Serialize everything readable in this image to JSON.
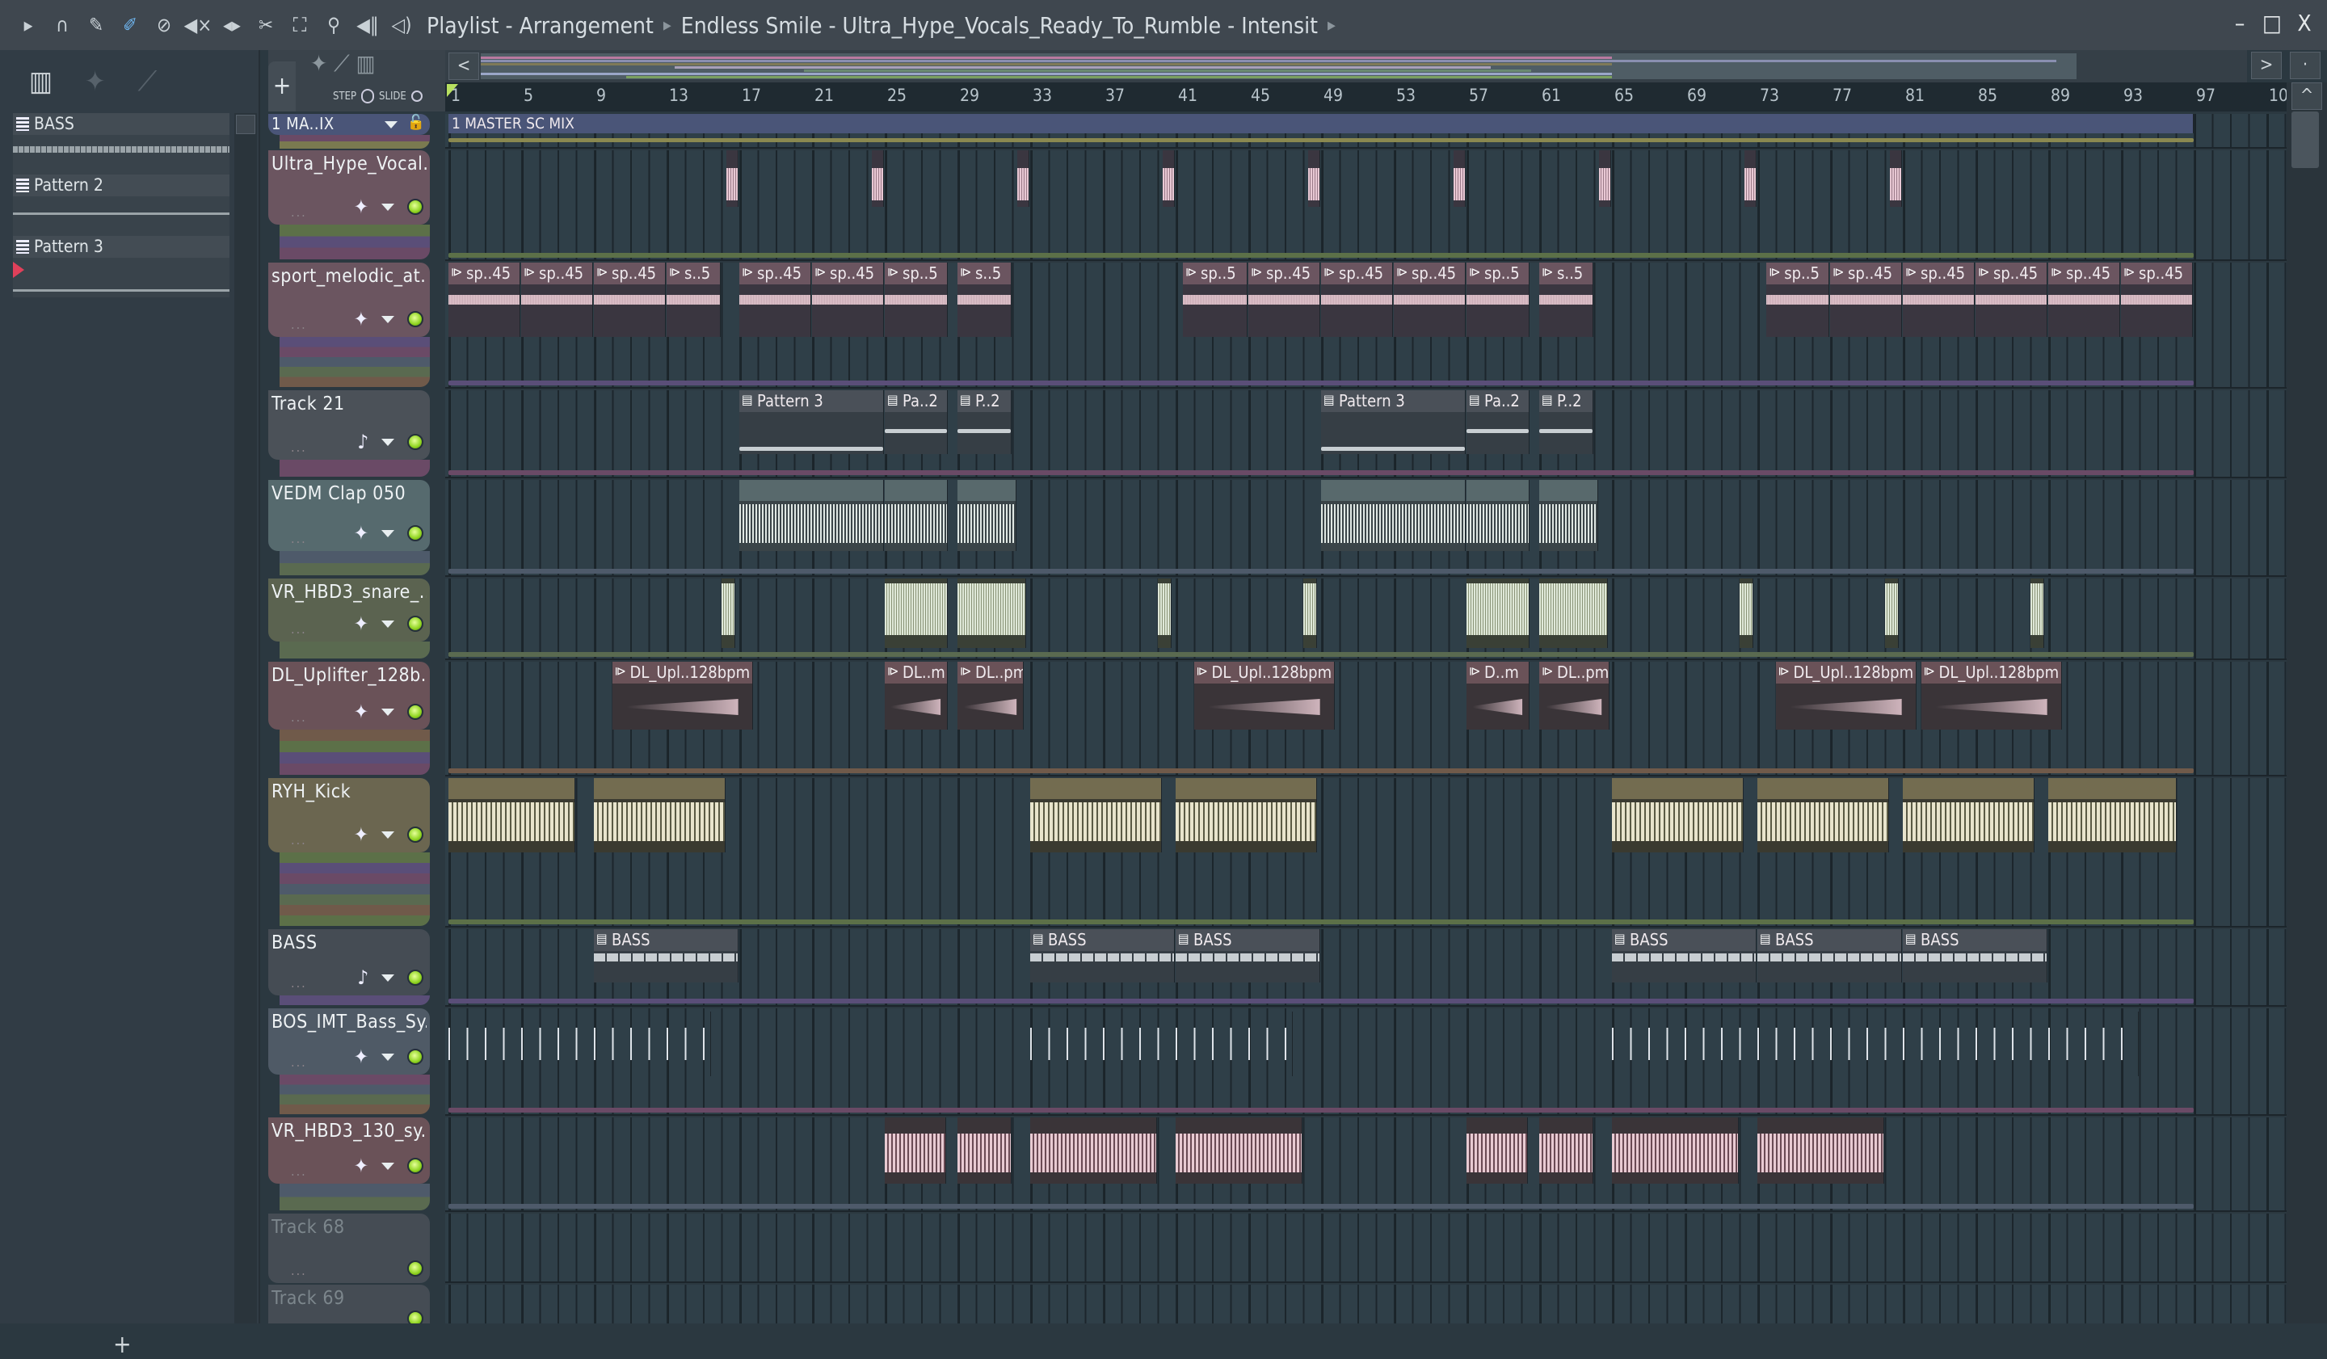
{
  "titlebar": {
    "icons": [
      "play-arrow-icon",
      "magnet-icon",
      "pencil-icon",
      "paint-brush-icon",
      "delete-icon",
      "mute-icon",
      "slip-icon",
      "slice-icon",
      "select-icon",
      "zoom-icon",
      "playback-icon",
      "speaker-icon"
    ],
    "breadcrumb": [
      "Playlist - Arrangement",
      "Endless Smile - Ultra_Hype_Vocals_Ready_To_Rumble - Intensit"
    ],
    "window_buttons": {
      "minimize": "–",
      "maximize": "□",
      "close": "X"
    }
  },
  "picker": {
    "patterns": [
      {
        "label": "BASS"
      },
      {
        "label": "Pattern 2"
      },
      {
        "label": "Pattern 3"
      }
    ],
    "add_label": "+"
  },
  "toolbar": {
    "add_label": "+",
    "step_label": "STEP",
    "slide_label": "SLIDE"
  },
  "overview": {
    "left_label": "<",
    "right_label": ">",
    "up_label": "^"
  },
  "ruler": [
    "1",
    "5",
    "9",
    "13",
    "17",
    "21",
    "25",
    "29",
    "33",
    "37",
    "41",
    "45",
    "49",
    "53",
    "57",
    "61",
    "65",
    "69",
    "73",
    "77",
    "81",
    "85",
    "89",
    "93",
    "97",
    "10"
  ],
  "master": {
    "name": "1 MA..IX",
    "clip_label": "1 MASTER SC MIX"
  },
  "tracks": [
    {
      "name": "Ultra_Hype_Vocal..",
      "kind": "audio",
      "color": "#6b5560",
      "clips": [
        [
          16.3,
          0.7,
          "",
          "vox"
        ],
        [
          24.3,
          0.7,
          "",
          "vox"
        ],
        [
          32.3,
          0.7,
          "",
          "vox"
        ],
        [
          40.3,
          0.7,
          "",
          "vox"
        ],
        [
          48.3,
          0.7,
          "",
          "vox"
        ],
        [
          56.3,
          0.7,
          "",
          "vox"
        ],
        [
          64.3,
          0.7,
          "",
          "vox"
        ],
        [
          72.3,
          0.7,
          "",
          "vox"
        ],
        [
          80.3,
          0.7,
          "",
          "vox"
        ]
      ]
    },
    {
      "name": "sport_melodic_at..",
      "kind": "audio",
      "color": "#6b5560",
      "clips": [
        [
          1,
          4,
          "sp..45",
          "flat"
        ],
        [
          5,
          4,
          "sp..45",
          "flat"
        ],
        [
          9,
          4,
          "sp..45",
          "flat"
        ],
        [
          13,
          3,
          "s..5",
          "flat"
        ],
        [
          17,
          4,
          "sp..45",
          "flat"
        ],
        [
          21,
          4,
          "sp..45",
          "flat"
        ],
        [
          25,
          3.5,
          "sp..5",
          "flat"
        ],
        [
          29,
          3,
          "s..5",
          "flat"
        ],
        [
          41.4,
          3.6,
          "sp..5",
          "flat"
        ],
        [
          45,
          4,
          "sp..45",
          "flat"
        ],
        [
          49,
          4,
          "sp..45",
          "flat"
        ],
        [
          53,
          4,
          "sp..45",
          "flat"
        ],
        [
          57,
          3.5,
          "sp..5",
          "flat"
        ],
        [
          61,
          3,
          "s..5",
          "flat"
        ],
        [
          73.5,
          3.5,
          "sp..5",
          "flat"
        ],
        [
          77,
          4,
          "sp..45",
          "flat"
        ],
        [
          81,
          4,
          "sp..45",
          "flat"
        ],
        [
          85,
          4,
          "sp..45",
          "flat"
        ],
        [
          89,
          4,
          "sp..45",
          "flat"
        ],
        [
          93,
          4,
          "sp..45",
          "flat"
        ]
      ]
    },
    {
      "name": "Track 21",
      "kind": "pattern",
      "color": "#4b5158",
      "clips": [
        [
          17,
          8,
          "Pattern 3",
          "pat"
        ],
        [
          25,
          3.5,
          "Pa..2",
          "pat"
        ],
        [
          29,
          3,
          "P..2",
          "pat"
        ],
        [
          49,
          8,
          "Pattern 3",
          "pat"
        ],
        [
          57,
          3.5,
          "Pa..2",
          "pat"
        ],
        [
          61,
          3,
          "P..2",
          "pat"
        ]
      ]
    },
    {
      "name": "VEDM Clap 050",
      "kind": "audio",
      "color": "#566a6e",
      "clips": [
        [
          17,
          8,
          "",
          "clap"
        ],
        [
          25,
          3.5,
          "",
          "clap"
        ],
        [
          29,
          3.3,
          "",
          "clap"
        ],
        [
          49,
          8,
          "",
          "clap"
        ],
        [
          57,
          3.5,
          "",
          "clap"
        ],
        [
          61,
          3.3,
          "",
          "clap"
        ]
      ]
    },
    {
      "name": "VR_HBD3_snare_..",
      "kind": "audio",
      "color": "#5b6350",
      "clips": [
        [
          16,
          0.8,
          "",
          "snare"
        ],
        [
          25,
          3.5,
          "",
          "snare"
        ],
        [
          29,
          3.8,
          "",
          "snare"
        ],
        [
          40,
          0.8,
          "",
          "snare"
        ],
        [
          48,
          0.8,
          "",
          "snare"
        ],
        [
          57,
          3.5,
          "",
          "snare"
        ],
        [
          61,
          3.8,
          "",
          "snare"
        ],
        [
          72,
          0.8,
          "",
          "snare"
        ],
        [
          80,
          0.8,
          "",
          "snare"
        ],
        [
          88,
          0.8,
          "",
          "snare"
        ]
      ]
    },
    {
      "name": "DL_Uplifter_128b..",
      "kind": "audio",
      "color": "#6a5258",
      "clips": [
        [
          10,
          7.8,
          "DL_Upl..128bpm",
          "rise"
        ],
        [
          25,
          3.5,
          "DL..m",
          "rise"
        ],
        [
          29,
          3.7,
          "DL..pm",
          "rise"
        ],
        [
          42,
          7.8,
          "DL_Upl..128bpm",
          "rise"
        ],
        [
          57,
          3.5,
          "D..m",
          "rise"
        ],
        [
          61,
          3.9,
          "DL..pm",
          "rise"
        ],
        [
          74,
          7.8,
          "DL_Upl..128bpm",
          "rise"
        ],
        [
          82,
          7.8,
          "DL_Upl..128bpm",
          "rise"
        ]
      ]
    },
    {
      "name": "RYH_Kick",
      "kind": "audio",
      "color": "#6b6650",
      "clips": [
        [
          1,
          7,
          "",
          "kick"
        ],
        [
          9,
          7.3,
          "",
          "kick"
        ],
        [
          33,
          7.3,
          "",
          "kick"
        ],
        [
          41,
          7.8,
          "",
          "kick"
        ],
        [
          65,
          7.3,
          "",
          "kick"
        ],
        [
          73,
          7.3,
          "",
          "kick"
        ],
        [
          81,
          7.3,
          "",
          "kick"
        ],
        [
          89,
          7.1,
          "",
          "kick"
        ]
      ]
    },
    {
      "name": "BASS",
      "kind": "pattern",
      "color": "#454c54",
      "clips": [
        [
          9,
          8,
          "BASS",
          "bass"
        ],
        [
          33,
          8,
          "BASS",
          "bass"
        ],
        [
          41,
          8,
          "BASS",
          "bass"
        ],
        [
          65,
          8,
          "BASS",
          "bass"
        ],
        [
          73,
          8,
          "BASS",
          "bass"
        ],
        [
          81,
          8,
          "BASS",
          "bass"
        ]
      ]
    },
    {
      "name": "BOS_IMT_Bass_Sy..",
      "kind": "audio",
      "color": "#4f5a66",
      "clips": [
        [
          1,
          14.5,
          "",
          "ticks"
        ],
        [
          33,
          14.5,
          "",
          "ticks"
        ],
        [
          65,
          29,
          "",
          "ticks"
        ]
      ]
    },
    {
      "name": "VR_HBD3_130_sy..",
      "kind": "audio",
      "color": "#6a5258",
      "clips": [
        [
          25,
          3.4,
          "",
          "sy"
        ],
        [
          29,
          3,
          "",
          "sy"
        ],
        [
          33,
          7,
          "",
          "sy"
        ],
        [
          41,
          7,
          "",
          "sy"
        ],
        [
          57,
          3.4,
          "",
          "sy"
        ],
        [
          61,
          3,
          "",
          "sy"
        ],
        [
          65,
          7,
          "",
          "sy"
        ],
        [
          73,
          7,
          "",
          "sy"
        ]
      ]
    },
    {
      "name": "Track 68",
      "kind": "empty",
      "color": "#454c54",
      "clips": []
    },
    {
      "name": "Track 69",
      "kind": "empty",
      "color": "#454c54",
      "clips": []
    }
  ]
}
